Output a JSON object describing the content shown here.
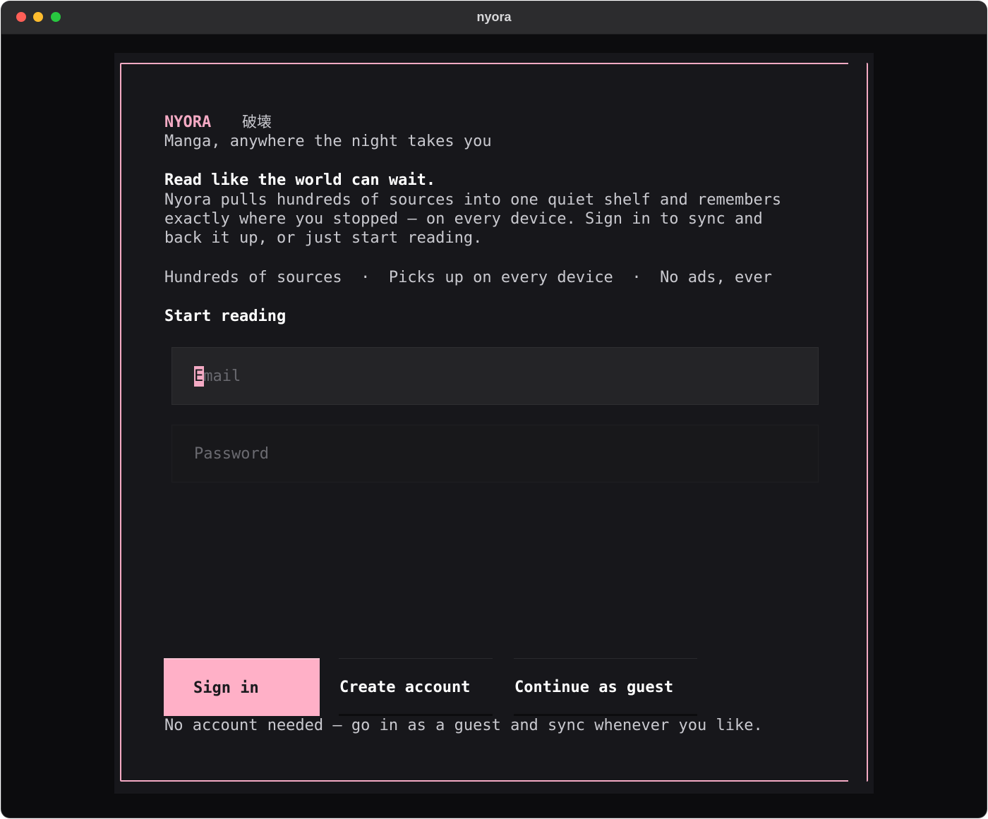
{
  "window": {
    "title": "nyora"
  },
  "brand": {
    "name": "NYORA",
    "kanji": "破壊",
    "tagline": "Manga, anywhere the night takes you"
  },
  "intro": {
    "headline": "Read like the world can wait.",
    "body_lines": [
      "Nyora pulls hundreds of sources into one quiet shelf and remembers",
      "exactly where you stopped — on every device. Sign in to sync and",
      "back it up, or just start reading."
    ]
  },
  "features": [
    "Hundreds of sources",
    "Picks up on every device",
    "No ads, ever"
  ],
  "features_separator": "·",
  "form": {
    "heading": "Start reading",
    "email": {
      "placeholder": "Email",
      "value": ""
    },
    "password": {
      "placeholder": "Password",
      "value": ""
    }
  },
  "actions": {
    "sign_in": "Sign in",
    "create_account": "Create account",
    "continue_guest": "Continue as guest"
  },
  "hint": "No account needed — go in as a guest and sync whenever you like.",
  "colors": {
    "accent": "#f4aac4",
    "button_fill": "#ffb0c7",
    "background": "#17171b",
    "text": "#c9c9cf"
  }
}
